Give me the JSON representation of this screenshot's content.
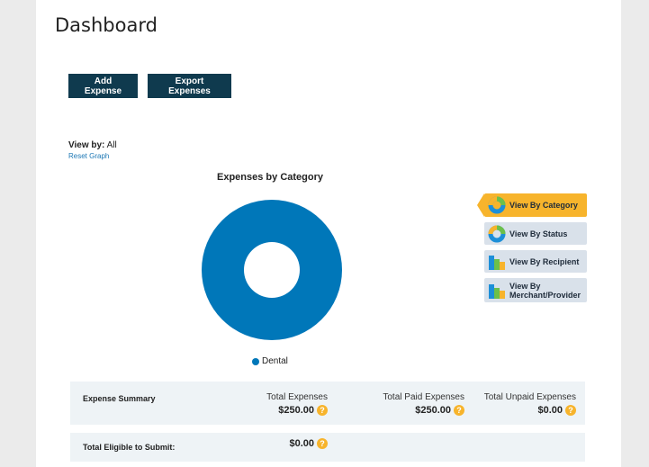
{
  "page": {
    "title": "Dashboard"
  },
  "actions": {
    "add_label": "Add Expense",
    "export_label": "Export Expenses"
  },
  "filter": {
    "view_by_label": "View by:",
    "view_by_value": "All",
    "reset_label": "Reset Graph"
  },
  "chart_data": {
    "type": "pie",
    "title": "Expenses by Category",
    "categories": [
      "Dental"
    ],
    "values": [
      250.0
    ],
    "colors": [
      "#0077b9"
    ],
    "legend": "bottom"
  },
  "view_buttons": [
    {
      "label": "View By Category",
      "active": true,
      "icon": "donut-icon"
    },
    {
      "label": "View By Status",
      "active": false,
      "icon": "donut-icon"
    },
    {
      "label": "View By Recipient",
      "active": false,
      "icon": "bar-chart-icon"
    },
    {
      "label_line1": "View By",
      "label_line2": "Merchant/Provider",
      "active": false,
      "icon": "bar-chart-icon"
    }
  ],
  "summary": {
    "title": "Expense Summary",
    "total_label": "Total Expenses",
    "total_value": "$250.00",
    "paid_label": "Total Paid Expenses",
    "paid_value": "$250.00",
    "unpaid_label": "Total Unpaid Expenses",
    "unpaid_value": "$0.00"
  },
  "eligible": {
    "label": "Total Eligible to Submit:",
    "value": "$0.00"
  },
  "help_glyph": "?"
}
